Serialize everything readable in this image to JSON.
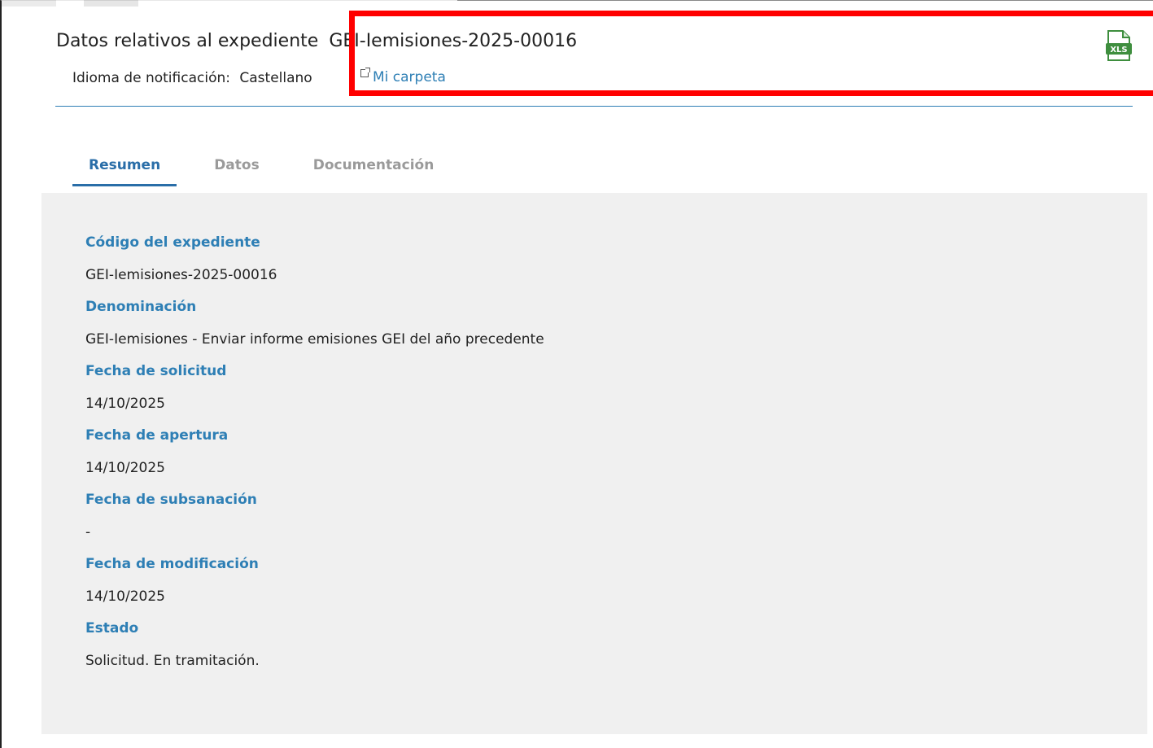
{
  "header": {
    "title_prefix": "Datos relativos al expediente",
    "title_code": "GEI-Iemisiones-2025-00016",
    "language_label": "Idioma de notificación:",
    "language_value": "Castellano",
    "folder_link": "Mi carpeta",
    "export_icon": "xls-file-icon"
  },
  "tabs": [
    {
      "label": "Resumen",
      "active": true
    },
    {
      "label": "Datos",
      "active": false
    },
    {
      "label": "Documentación",
      "active": false
    }
  ],
  "summary": {
    "fields": [
      {
        "label": "Código del expediente",
        "value": "GEI-Iemisiones-2025-00016"
      },
      {
        "label": "Denominación",
        "value": "GEI-Iemisiones - Enviar informe emisiones GEI del año precedente"
      },
      {
        "label": "Fecha de solicitud",
        "value": "14/10/2025"
      },
      {
        "label": "Fecha de apertura",
        "value": "14/10/2025"
      },
      {
        "label": "Fecha de subsanación",
        "value": "-"
      },
      {
        "label": "Fecha de modificación",
        "value": "14/10/2025"
      },
      {
        "label": "Estado",
        "value": "Solicitud. En tramitación."
      }
    ]
  },
  "colors": {
    "accent": "#2e7fb5",
    "tab_active": "#2a6ea8",
    "highlight": "#ff0000",
    "panel_bg": "#f0f0f0"
  }
}
